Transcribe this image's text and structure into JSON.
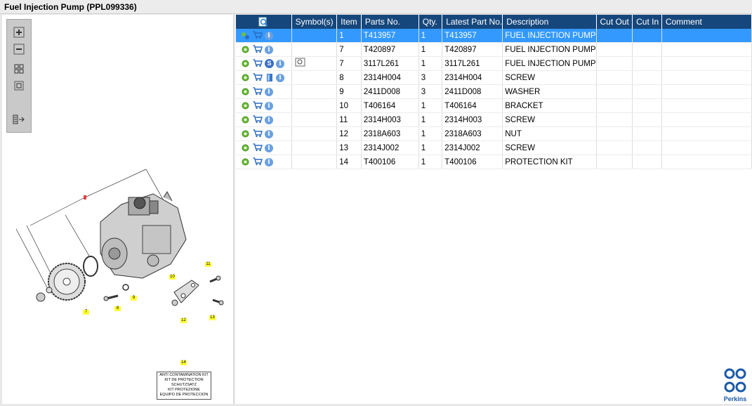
{
  "window": {
    "title": "Fuel Injection Pump (PPL099336)"
  },
  "toolbar": {
    "buttons": [
      {
        "name": "zoom-in",
        "icon": "plus-icon"
      },
      {
        "name": "zoom-out",
        "icon": "minus-icon"
      },
      {
        "name": "fit-view",
        "icon": "grid-icon"
      },
      {
        "name": "actual-size",
        "icon": "square-icon"
      },
      {
        "name": "export",
        "icon": "export-icon"
      }
    ]
  },
  "diagram": {
    "callouts": [
      "7",
      "8",
      "9",
      "10",
      "11",
      "12",
      "13",
      "14"
    ],
    "kit_lines": [
      "ANTI CONTAMINATION KIT",
      "KIT DE PROTECTION",
      "SCHUTZSATZ",
      "KIT PROTEZIONE",
      "EQUIPO DE PROTECCION"
    ]
  },
  "table": {
    "columns": [
      "",
      "Symbol(s)",
      "Item",
      "Parts No.",
      "Qty.",
      "Latest Part No.",
      "Description",
      "Cut Out",
      "Cut In",
      "Comment"
    ],
    "rows": [
      {
        "item": "1",
        "part": "T413957",
        "qty": "1",
        "latest": "T413957",
        "desc": "FUEL INJECTION PUMP",
        "selected": true,
        "extra": ""
      },
      {
        "item": "7",
        "part": "T420897",
        "qty": "1",
        "latest": "T420897",
        "desc": "FUEL INJECTION PUMP",
        "selected": false,
        "extra": ""
      },
      {
        "item": "7",
        "part": "3117L261",
        "qty": "1",
        "latest": "3117L261",
        "desc": "FUEL INJECTION PUMP",
        "selected": false,
        "extra": "s"
      },
      {
        "item": "8",
        "part": "2314H004",
        "qty": "3",
        "latest": "2314H004",
        "desc": "SCREW",
        "selected": false,
        "extra": "book"
      },
      {
        "item": "9",
        "part": "2411D008",
        "qty": "3",
        "latest": "2411D008",
        "desc": "WASHER",
        "selected": false,
        "extra": ""
      },
      {
        "item": "10",
        "part": "T406164",
        "qty": "1",
        "latest": "T406164",
        "desc": "BRACKET",
        "selected": false,
        "extra": ""
      },
      {
        "item": "11",
        "part": "2314H003",
        "qty": "1",
        "latest": "2314H003",
        "desc": "SCREW",
        "selected": false,
        "extra": ""
      },
      {
        "item": "12",
        "part": "2318A603",
        "qty": "1",
        "latest": "2318A603",
        "desc": "NUT",
        "selected": false,
        "extra": ""
      },
      {
        "item": "13",
        "part": "2314J002",
        "qty": "1",
        "latest": "2314J002",
        "desc": "SCREW",
        "selected": false,
        "extra": ""
      },
      {
        "item": "14",
        "part": "T400106",
        "qty": "1",
        "latest": "T400106",
        "desc": "PROTECTION KIT",
        "selected": false,
        "extra": ""
      }
    ]
  },
  "logo": {
    "text": "Perkins"
  },
  "colors": {
    "header": "#16477c",
    "selected": "#3399ff",
    "logo": "#1a5aa8"
  }
}
